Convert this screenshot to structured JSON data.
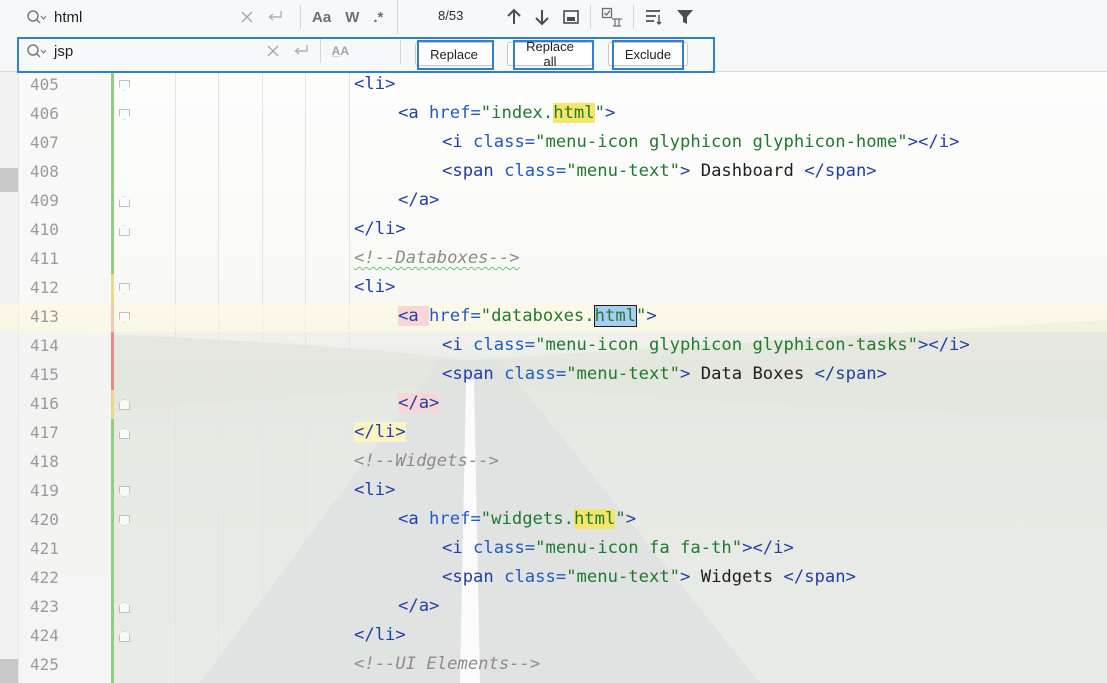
{
  "find": {
    "query": "html",
    "match_case_label": "Aa",
    "whole_words_label": "W",
    "regex_label": ".*",
    "match_count": "8/53"
  },
  "replace": {
    "query": "jsp",
    "preserve_case_label": "A̲A",
    "buttons": {
      "replace": "Replace",
      "replace_all": "Replace all",
      "exclude": "Exclude"
    }
  },
  "editor": {
    "lines": [
      {
        "n": "405"
      },
      {
        "n": "406"
      },
      {
        "n": "407"
      },
      {
        "n": "408"
      },
      {
        "n": "409"
      },
      {
        "n": "410"
      },
      {
        "n": "411"
      },
      {
        "n": "412"
      },
      {
        "n": "413"
      },
      {
        "n": "414"
      },
      {
        "n": "415"
      },
      {
        "n": "416"
      },
      {
        "n": "417"
      },
      {
        "n": "418"
      },
      {
        "n": "419"
      },
      {
        "n": "420"
      },
      {
        "n": "421"
      },
      {
        "n": "422"
      },
      {
        "n": "423"
      },
      {
        "n": "424"
      },
      {
        "n": "425"
      }
    ],
    "code": {
      "l405": "<li>",
      "l406_open": "<a ",
      "l406_attr": "href=",
      "l406_q1": "\"index.",
      "l406_match": "html",
      "l406_q2": "\"",
      "l406_close": ">",
      "l407_open": "<i ",
      "l407_attr": "class=",
      "l407_val": "\"menu-icon glyphicon glyphicon-home\"",
      "l407_close": "></i>",
      "l408_open": "<span ",
      "l408_attr": "class=",
      "l408_val": "\"menu-text\"",
      "l408_gt": ">",
      "l408_text": " Dashboard ",
      "l408_close": "</span>",
      "l409": "</a>",
      "l410": "</li>",
      "l411": "<!--Databoxes-->",
      "l412": "<li>",
      "l413_open": "<a ",
      "l413_attr": "href=",
      "l413_q1": "\"databoxes.",
      "l413_match": "html",
      "l413_q2": "\"",
      "l413_close": ">",
      "l414_open": "<i ",
      "l414_attr": "class=",
      "l414_val": "\"menu-icon glyphicon glyphicon-tasks\"",
      "l414_close": "></i>",
      "l415_open": "<span ",
      "l415_attr": "class=",
      "l415_val": "\"menu-text\"",
      "l415_gt": ">",
      "l415_text": " Data Boxes ",
      "l415_close": "</span>",
      "l416": "</a>",
      "l417": "</li>",
      "l418": "<!--Widgets-->",
      "l419": "<li>",
      "l420_open": "<a ",
      "l420_attr": "href=",
      "l420_q1": "\"widgets.",
      "l420_match": "html",
      "l420_q2": "\"",
      "l420_close": ">",
      "l421_open": "<i ",
      "l421_attr": "class=",
      "l421_val": "\"menu-icon fa fa-th\"",
      "l421_close": "></i>",
      "l422_open": "<span ",
      "l422_attr": "class=",
      "l422_val": "\"menu-text\"",
      "l422_gt": ">",
      "l422_text": " Widgets ",
      "l422_close": "</span>",
      "l423": "</a>",
      "l424": "</li>",
      "l425": "<!--UI Elements-->"
    }
  },
  "icons": {
    "search": "search-icon",
    "clear": "clear-icon",
    "history": "history-icon",
    "prev": "arrow-up-icon",
    "next": "arrow-down-icon",
    "in_selection": "in-selection-icon",
    "select_all": "select-all-occurrences-icon",
    "multiline": "multiline-icon",
    "filter": "filter-icon"
  },
  "colors": {
    "match": "#f5e56b",
    "current_match": "#a8cdf2",
    "highlight_box": "#2f7fd3"
  }
}
